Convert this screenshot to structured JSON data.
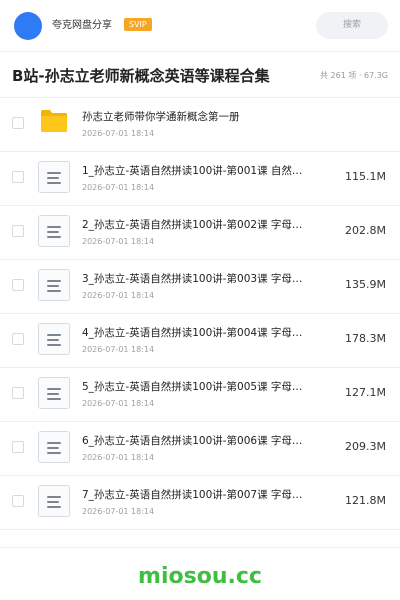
{
  "header": {
    "sharer_name": "夸克网盘分享",
    "badge": "SVIP",
    "search_placeholder": "搜索"
  },
  "share": {
    "title": "B站-孙志立老师新概念英语等课程合集",
    "meta": "共 261 项 · 67.3G"
  },
  "files": [
    {
      "type": "folder",
      "name": "孙志立老师带你学通新概念第一册",
      "date": "2026-07-01 18:14",
      "size": ""
    },
    {
      "type": "file",
      "name": "1_孙志立-英语自然拼读100讲-第001课 自然…",
      "date": "2026-07-01 18:14",
      "size": "115.1M"
    },
    {
      "type": "file",
      "name": "2_孙志立-英语自然拼读100讲-第002课 字母…",
      "date": "2026-07-01 18:14",
      "size": "202.8M"
    },
    {
      "type": "file",
      "name": "3_孙志立-英语自然拼读100讲-第003课 字母…",
      "date": "2026-07-01 18:14",
      "size": "135.9M"
    },
    {
      "type": "file",
      "name": "4_孙志立-英语自然拼读100讲-第004课 字母…",
      "date": "2026-07-01 18:14",
      "size": "178.3M"
    },
    {
      "type": "file",
      "name": "5_孙志立-英语自然拼读100讲-第005课 字母…",
      "date": "2026-07-01 18:14",
      "size": "127.1M"
    },
    {
      "type": "file",
      "name": "6_孙志立-英语自然拼读100讲-第006课 字母…",
      "date": "2026-07-01 18:14",
      "size": "209.3M"
    },
    {
      "type": "file",
      "name": "7_孙志立-英语自然拼读100讲-第007课 字母…",
      "date": "2026-07-01 18:14",
      "size": "121.8M"
    }
  ],
  "footer": {
    "brand": "miosou.cc"
  },
  "colors": {
    "accent": "#2f7bf5",
    "svip": "#f5a623",
    "folder": "#ffc61a",
    "brand": "#3fbf3f"
  }
}
